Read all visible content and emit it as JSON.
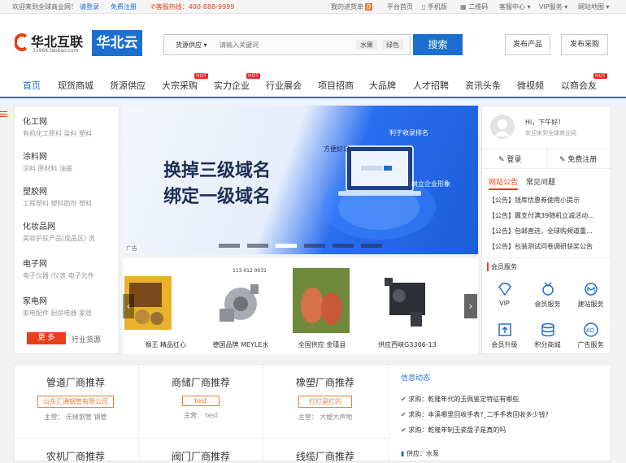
{
  "topbar": {
    "welcome": "欢迎来到全球商业网！",
    "login": "请登录",
    "register": "免费注册",
    "hotline": "客服热线：400-888-9999",
    "my_purchase": "我的进货单",
    "my_purchase_badge": "0",
    "home": "平台首页",
    "mobile": "手机版",
    "qrcode": "二维码",
    "service_center": "客服中心 ▾",
    "vip": "VIP服务 ▾",
    "sitemap": "网站地图 ▾"
  },
  "header": {
    "logo_text": "华北互联",
    "logo_url": "31966.taobao.com",
    "logo_cloud": "华北云",
    "search_category": "货源供应",
    "search_placeholder": "请输入关键词",
    "hot_tags": [
      "水果",
      "绿色"
    ],
    "search_button": "搜索",
    "publish_product": "发布产品",
    "publish_purchase": "发布采购"
  },
  "nav": {
    "items": [
      {
        "label": "首页",
        "hot": false
      },
      {
        "label": "现货商城",
        "hot": false
      },
      {
        "label": "货源供应",
        "hot": false
      },
      {
        "label": "大宗采购",
        "hot": true
      },
      {
        "label": "实力企业",
        "hot": true
      },
      {
        "label": "行业展会",
        "hot": false
      },
      {
        "label": "项目招商",
        "hot": false
      },
      {
        "label": "大品牌",
        "hot": false
      },
      {
        "label": "人才招聘",
        "hot": false
      },
      {
        "label": "资讯头条",
        "hot": false
      },
      {
        "label": "微视频",
        "hot": false
      },
      {
        "label": "以商会友",
        "hot": true
      }
    ],
    "hot_label": "HOT"
  },
  "categories": [
    {
      "title": "化工网",
      "subs": "有机化工原料  染料  塑料"
    },
    {
      "title": "涂料网",
      "subs": "涂料  原材料  油墨"
    },
    {
      "title": "塑胶网",
      "subs": "工程塑料  塑料助剂  塑料"
    },
    {
      "title": "化妆品网",
      "subs": "美容护肤产品(成品区)  洗"
    },
    {
      "title": "电子网",
      "subs": "电子仪器 /仪表  电子元件"
    },
    {
      "title": "家电网",
      "subs": "家电配件  厨房电器  家居"
    }
  ],
  "more_button": "更 多",
  "industry_source": "行业货源",
  "banner": {
    "line1": "换掉三级域名",
    "line2": "绑定一级域名",
    "label_remember": "方便好记",
    "label_seo": "利于收录排名",
    "label_image": "树立企业形象",
    "ad_tag": "广告",
    "slide_count": 6,
    "active_slide": 3
  },
  "products": [
    {
      "caption": "猴王 精品红心"
    },
    {
      "caption": "德国品牌 MEYLE水"
    },
    {
      "caption": "全国供应 金瑾县"
    },
    {
      "caption": "供应西峡G3306-13"
    }
  ],
  "product_code": "113 012 0031",
  "user": {
    "greeting": "Hi，下午好！",
    "welcome": "欢迎来到全球商业网",
    "login": "登录",
    "register": "免费注册"
  },
  "notice_tabs": [
    "网站公告",
    "常见问题"
  ],
  "notices": [
    "【公告】钱库优惠券使用小提示",
    "【公告】翼支付满39随机立减活动...",
    "【公告】包邮直送，全球购频道重...",
    "【公告】包装测试问卷调研获奖公告"
  ],
  "member_service_title": "会员服务",
  "services": [
    {
      "label": "VIP",
      "icon": "diamond-icon"
    },
    {
      "label": "会员服务",
      "icon": "medal-icon"
    },
    {
      "label": "建站服务",
      "icon": "site-icon"
    },
    {
      "label": "会员升级",
      "icon": "upgrade-icon"
    },
    {
      "label": "积分商城",
      "icon": "coins-icon"
    },
    {
      "label": "广告服务",
      "icon": "ad-icon"
    }
  ],
  "recommends": [
    {
      "title": "管道厂商推荐",
      "company": "山东汇通钢管有限公司",
      "main": "主营：  无缝钢管  钢管"
    },
    {
      "title": "商储厂商推荐",
      "company": "test",
      "main": "主营：  test"
    },
    {
      "title": "橡塑厂商推荐",
      "company": "打打是打的",
      "main": "主营：  大嫂大声地"
    },
    {
      "title": "农机厂商推荐"
    },
    {
      "title": "阀门厂商推荐"
    },
    {
      "title": "线缆厂商推荐"
    }
  ],
  "info": {
    "title": "信息动态",
    "items": [
      "求购：乾隆年代的玉佩鉴定特征有哪些",
      "求购：本溪哪里回收手表?_二手手表回收多少钱?",
      "求购：乾隆年制玉瓷盘子是真的吗"
    ],
    "supply": "供应：水泵"
  },
  "colors": {
    "brand_blue": "#1a6fd0",
    "orange": "#f07a3a",
    "red": "#e8401c"
  }
}
